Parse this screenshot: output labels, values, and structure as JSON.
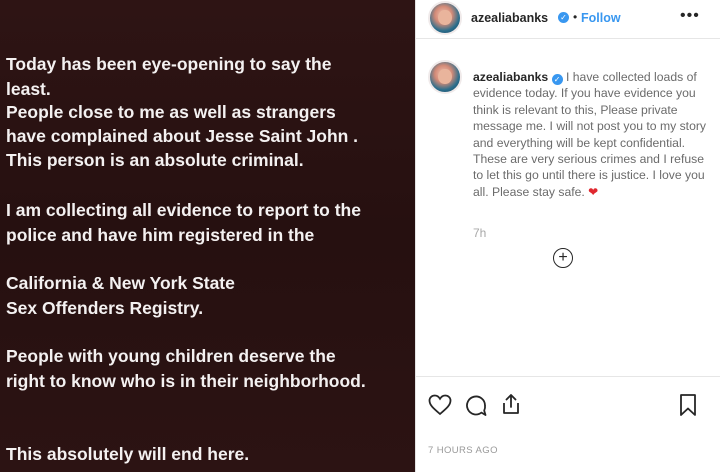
{
  "story": {
    "lines": [
      "Today has been eye-opening to say the",
      "least.",
      "People close to me as well as strangers",
      "have complained about Jesse Saint John .",
      "This person is an absolute criminal.",
      "I am collecting all evidence to report to the",
      "police and have him registered in the",
      "California & New York State",
      "Sex Offenders Registry.",
      "People with young children deserve the",
      "right to know who is in their neighborhood.",
      "This absolutely will end here."
    ]
  },
  "header": {
    "username": "azealiabanks",
    "separator": "•",
    "follow_label": "Follow",
    "more_label": "•••"
  },
  "caption": {
    "username": "azealiabanks",
    "text": "I have collected loads of evidence today. If you have evidence you think is relevant to this, Please private message me. I will not post you to my story and everything will be kept confidential. These are very serious crimes and I refuse to let this go until there is justice. I love you all. Please stay safe.",
    "emoji": "❤",
    "time": "7h"
  },
  "load_more_label": "+",
  "actions": {
    "icons": [
      "heart-icon",
      "comment-icon",
      "share-icon",
      "bookmark-icon"
    ],
    "date": "7 HOURS AGO"
  },
  "colors": {
    "story_background": "#2a1212",
    "story_text": "#f4f1f1",
    "link_blue": "#3897f0",
    "emoji_red": "#e0282f"
  }
}
